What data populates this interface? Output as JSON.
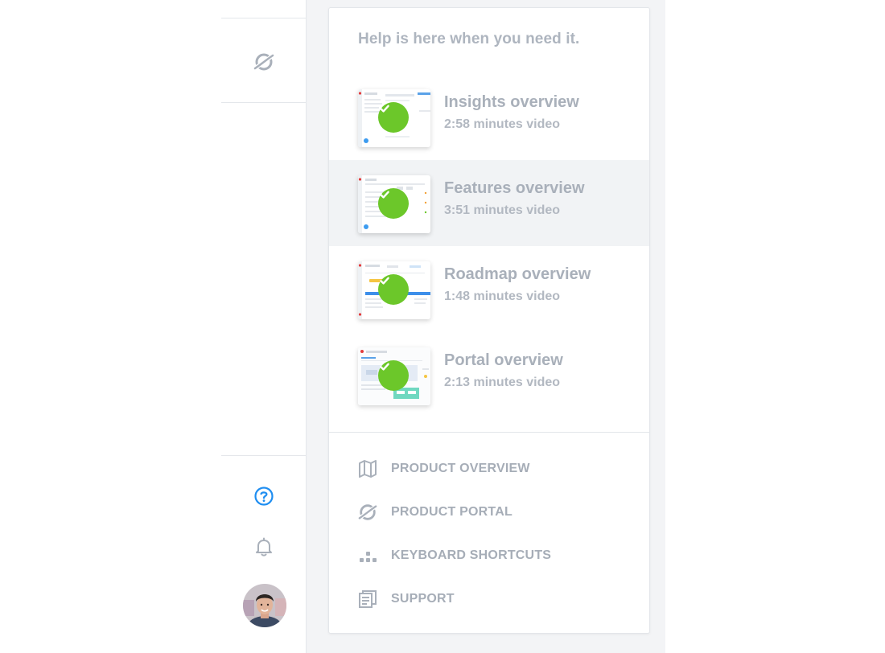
{
  "rail": {
    "top_icon": "portal-planet-icon",
    "help_icon": "help-circle-icon",
    "bell_icon": "bell-icon",
    "avatar": "user-avatar",
    "accent": "#1f8ef1"
  },
  "help_panel": {
    "heading": "Help is here when you need it.",
    "videos": [
      {
        "title": "Insights overview",
        "duration": "2:58 minutes video",
        "watched": true
      },
      {
        "title": "Features overview",
        "duration": "3:51 minutes video",
        "watched": true
      },
      {
        "title": "Roadmap overview",
        "duration": "1:48 minutes video",
        "watched": true
      },
      {
        "title": "Portal overview",
        "duration": "2:13 minutes video",
        "watched": true
      }
    ],
    "check_color": "#6cc72a",
    "links": [
      {
        "label": "PRODUCT OVERVIEW",
        "icon": "map-icon"
      },
      {
        "label": "PRODUCT PORTAL",
        "icon": "portal-planet-icon"
      },
      {
        "label": "KEYBOARD SHORTCUTS",
        "icon": "keyboard-dots-icon"
      },
      {
        "label": "SUPPORT",
        "icon": "document-stack-icon"
      }
    ]
  }
}
